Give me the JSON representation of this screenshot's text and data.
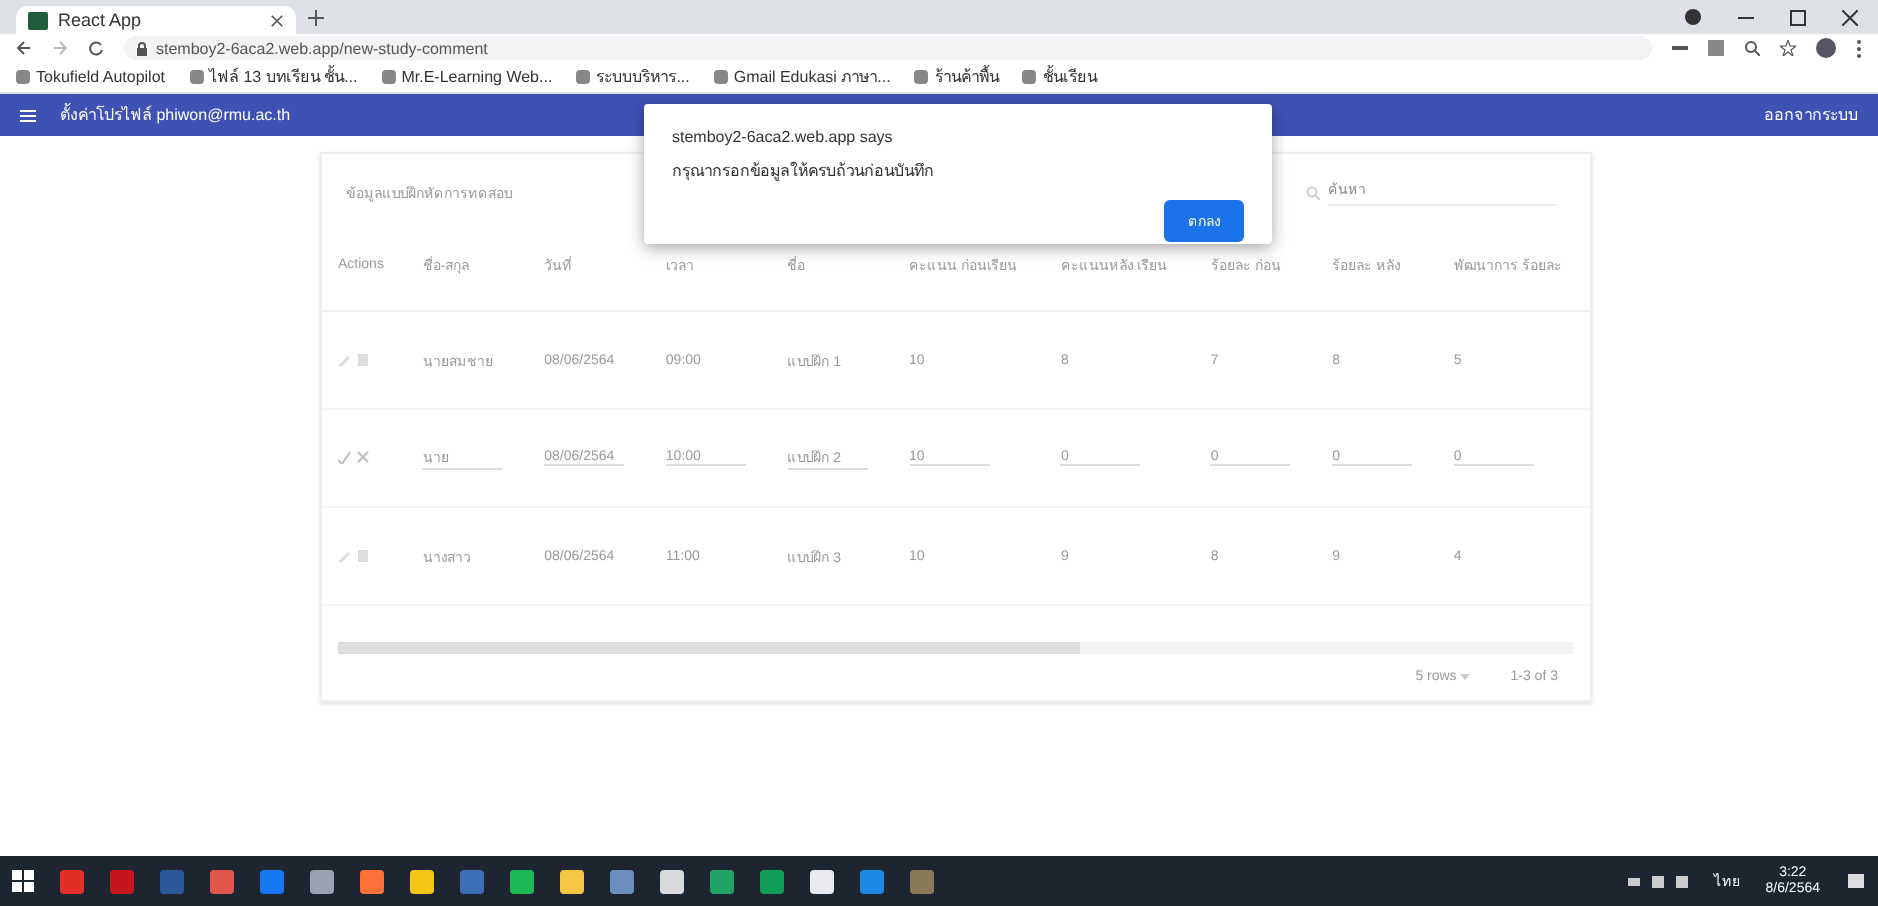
{
  "browser": {
    "tab": {
      "title": "React App"
    },
    "url": "stemboy2-6aca2.web.app/new-study-comment",
    "bookmarks": [
      {
        "label": "Tokufield Autopilot"
      },
      {
        "label": "ไฟล์ 13 บทเรียน ชั้น..."
      },
      {
        "label": "Mr.E-Learning Web..."
      },
      {
        "label": "ระบบบริหาร..."
      },
      {
        "label": "Gmail Edukasi ภาษา..."
      },
      {
        "label": "ร้านค้าพื้น"
      },
      {
        "label": "ชั้นเรียน"
      }
    ]
  },
  "app_bar": {
    "title": "ตั้งค่าโปรไฟล์ phiwon@rmu.ac.th",
    "action": "ออกจากระบบ"
  },
  "dialog": {
    "title": "stemboy2-6aca2.web.app says",
    "message": "กรุณากรอกข้อมูลให้ครบถ้วนก่อนบันทึก",
    "button": "ตกลง"
  },
  "table": {
    "title": "ข้อมูลแบบฝึกหัดการทดสอบ",
    "search": {
      "placeholder": "ค้นหา"
    },
    "columns": [
      "Actions",
      "ชื่อ-สกุล",
      "วันที่",
      "เวลา",
      "ชื่อ",
      "คะแนน ก่อนเรียน",
      "คะแนนหลัง เรียน",
      "ร้อยละ ก่อน",
      "ร้อยละ หลัง",
      "พัฒนาการ ร้อยละ"
    ],
    "rows": [
      {
        "editing": false,
        "cells": [
          "",
          "นายสมชาย",
          "08/06/2564",
          "09:00",
          "แบบฝึก 1",
          "10",
          "8",
          "7",
          "8",
          "5"
        ]
      },
      {
        "editing": true,
        "cells": [
          "",
          "นาย",
          "08/06/2564",
          "10:00",
          "แบบฝึก 2",
          "10",
          "0",
          "0",
          "0",
          "0"
        ]
      },
      {
        "editing": false,
        "cells": [
          "",
          "นางสาว",
          "08/06/2564",
          "11:00",
          "แบบฝึก 3",
          "10",
          "9",
          "8",
          "9",
          "4"
        ]
      }
    ],
    "pagination": {
      "rows_per_page": "5 rows",
      "range": "1-3 of 3"
    }
  },
  "taskbar": {
    "apps": [
      {
        "color": "#e52d27"
      },
      {
        "color": "#c4161c"
      },
      {
        "color": "#2b579a"
      },
      {
        "color": "#e2574c"
      },
      {
        "color": "#1877f2"
      },
      {
        "color": "#9aa4b1"
      },
      {
        "color": "#ff7139"
      },
      {
        "color": "#f5c518"
      },
      {
        "color": "#3c6fb6"
      },
      {
        "color": "#1db954"
      },
      {
        "color": "#f3c744"
      },
      {
        "color": "#6c8ebf"
      },
      {
        "color": "#d9d9d9"
      },
      {
        "color": "#21a366"
      },
      {
        "color": "#0f9d58"
      },
      {
        "color": "#e8eaed"
      },
      {
        "color": "#1e88e5"
      },
      {
        "color": "#8a7a5a"
      }
    ],
    "time": "3:22",
    "date": "8/6/2564",
    "lang": "ไทย"
  }
}
